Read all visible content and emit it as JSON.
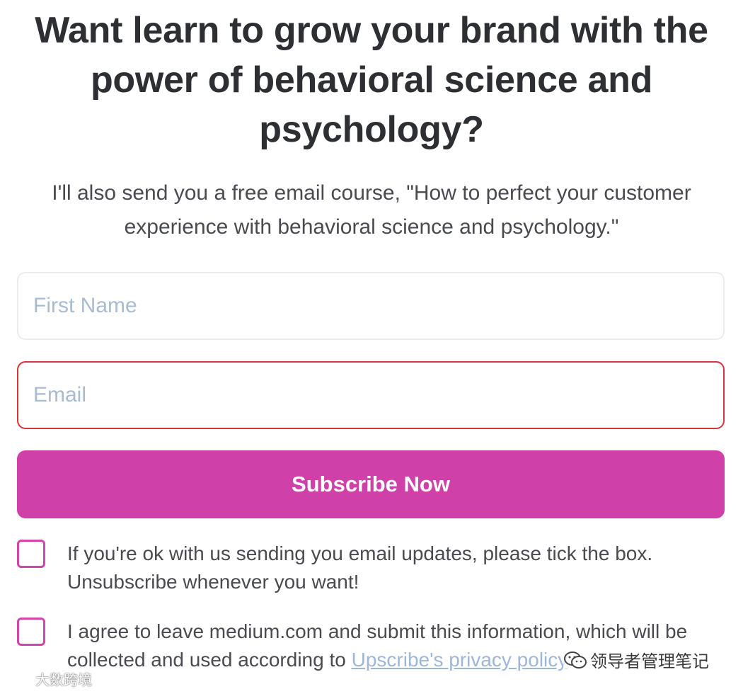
{
  "headline": "Want learn to grow your brand with the power of behavioral science and psychology?",
  "subtitle": "I'll also send you a free email course, \"How to perfect your customer experience with behavioral science and psychology.\"",
  "form": {
    "first_name_placeholder": "First Name",
    "email_placeholder": "Email",
    "subscribe_label": "Subscribe Now"
  },
  "consents": [
    {
      "text": "If you're ok with us sending you email updates, please tick the box. Unsubscribe whenever you want!",
      "checked": false
    },
    {
      "text_before": "I agree to leave medium.com and submit this information, which will be collected and used according to ",
      "link_text": "Upscribe's privacy policy",
      "checked": false
    }
  ],
  "watermarks": {
    "left": "大数跨境",
    "right": "领导者管理笔记"
  },
  "colors": {
    "accent": "#d040a9",
    "error_border": "#d8333a",
    "placeholder": "#a9bbd1",
    "link": "#9eb7d6"
  }
}
